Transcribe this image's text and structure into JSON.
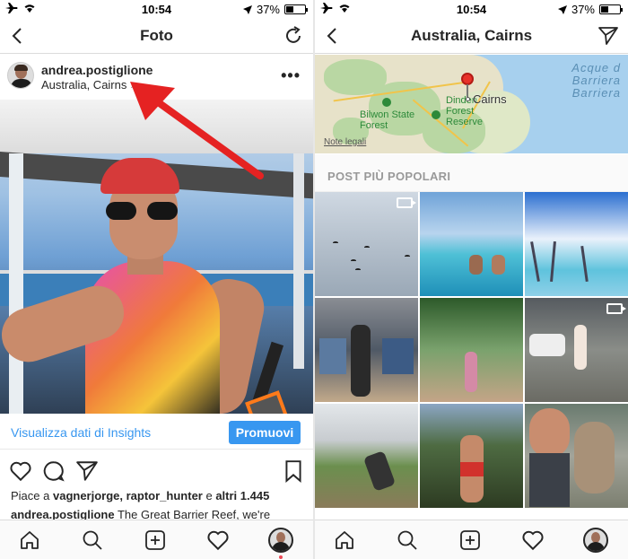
{
  "left": {
    "status": {
      "time": "10:54",
      "battery": "37%",
      "battery_level": 0.37
    },
    "nav": {
      "title": "Foto"
    },
    "post": {
      "username": "andrea.postiglione",
      "location": "Australia, Cairns",
      "more": "•••"
    },
    "insights": {
      "link": "Visualizza dati di Insights",
      "button": "Promuovi"
    },
    "likes": {
      "prefix": "Piace a ",
      "users": "vagnerjorge, raptor_hunter",
      "mid": " e ",
      "others": "altri 1.445"
    },
    "caption": {
      "user": "andrea.postiglione",
      "text": " The Great Barrier Reef, we're"
    }
  },
  "right": {
    "status": {
      "time": "10:54",
      "battery": "37%",
      "battery_level": 0.37
    },
    "nav": {
      "title": "Australia, Cairns"
    },
    "map": {
      "city": "Cairns",
      "park1": "Bilwon State Forest",
      "park1_line1": "Bilwon State",
      "park1_line2": "Forest",
      "park2_line1": "Dinden",
      "park2_line2": "Forest",
      "park2_line3": "Reserve",
      "sea_line1": "Acque d",
      "sea_line2": "Barriera",
      "sea_line3": "Barriera",
      "legal": "Note legali"
    },
    "section_title": "POST PIÙ POPOLARI"
  },
  "colors": {
    "accent": "#3897f0",
    "text": "#262626",
    "notification": "#ed4956",
    "pin": "#e8322a"
  },
  "icons": {
    "back": "chevron-left-icon",
    "refresh": "refresh-icon",
    "send": "paper-plane-icon",
    "like": "heart-icon",
    "comment": "comment-icon",
    "share": "paper-plane-icon",
    "save": "bookmark-icon",
    "home": "home-icon",
    "search": "search-icon",
    "add": "add-post-icon",
    "activity": "heart-icon",
    "profile": "profile-avatar-icon"
  }
}
